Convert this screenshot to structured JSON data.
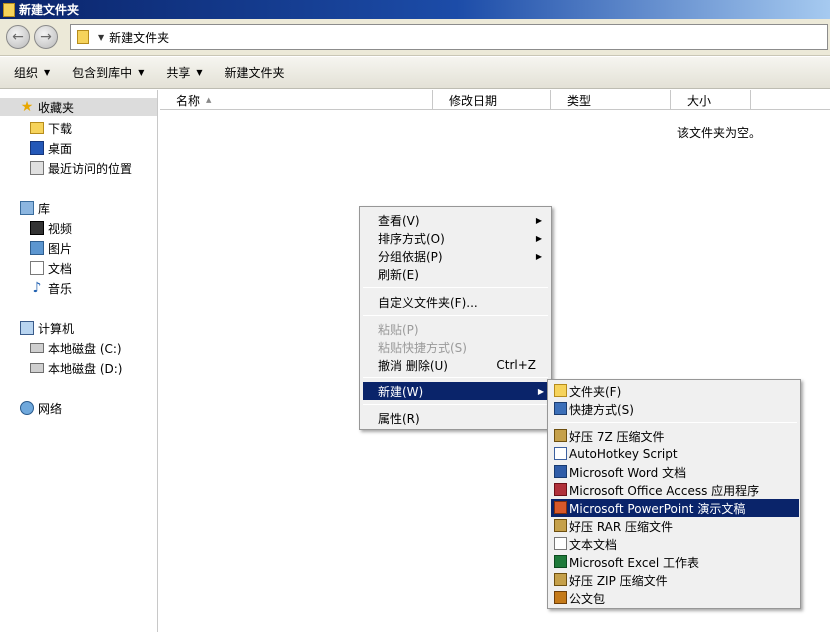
{
  "window": {
    "title": "新建文件夹"
  },
  "address": {
    "path": "新建文件夹"
  },
  "command_bar": {
    "organize": "组织",
    "include_library": "包含到库中",
    "share": "共享",
    "new_folder": "新建文件夹"
  },
  "nav": {
    "favorites": "收藏夹",
    "downloads": "下载",
    "desktop": "桌面",
    "recent": "最近访问的位置",
    "libraries": "库",
    "videos": "视频",
    "pictures": "图片",
    "documents": "文档",
    "music": "音乐",
    "computer": "计算机",
    "disk_c": "本地磁盘 (C:)",
    "disk_d": "本地磁盘 (D:)",
    "network": "网络"
  },
  "columns": {
    "name": "名称",
    "modified": "修改日期",
    "type": "类型",
    "size": "大小"
  },
  "empty_message": "该文件夹为空。",
  "context_menu": {
    "view": "查看(V)",
    "sort_by": "排序方式(O)",
    "group_by": "分组依据(P)",
    "refresh": "刷新(E)",
    "customize": "自定义文件夹(F)...",
    "paste": "粘贴(P)",
    "paste_shortcut": "粘贴快捷方式(S)",
    "undo_delete": "撤消 删除(U)",
    "undo_shortcut": "Ctrl+Z",
    "new": "新建(W)",
    "properties": "属性(R)"
  },
  "new_submenu": {
    "folder": "文件夹(F)",
    "shortcut": "快捷方式(S)",
    "zip7z": "好压 7Z 压缩文件",
    "ahk": "AutoHotkey Script",
    "word": "Microsoft Word 文档",
    "access": "Microsoft Office Access 应用程序",
    "ppt": "Microsoft PowerPoint 演示文稿",
    "rar": "好压 RAR 压缩文件",
    "txt": "文本文档",
    "excel": "Microsoft Excel 工作表",
    "zip": "好压 ZIP 压缩文件",
    "briefcase": "公文包"
  }
}
